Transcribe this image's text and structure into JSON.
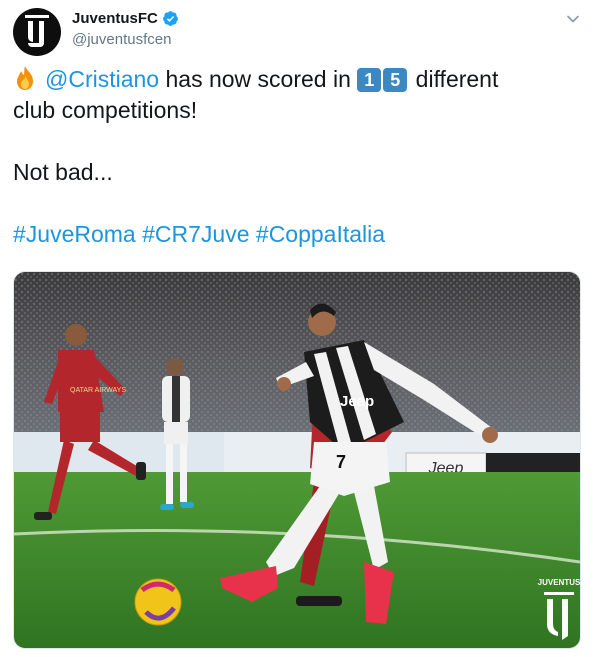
{
  "author": {
    "display_name": "JuventusFC",
    "handle": "@juventusfcen",
    "avatar_icon": "juventus-j-logo-icon",
    "verified_icon": "verified-badge-icon"
  },
  "menu": {
    "icon": "chevron-down-icon"
  },
  "tweet": {
    "emoji_icon": "fire-emoji-icon",
    "mention": "@Cristiano",
    "text_part1": "has now scored in",
    "keycap_1": "1",
    "keycap_2": "5",
    "text_part2": "different",
    "line2": "club competitions!",
    "line3": "Not bad...",
    "hashtags": [
      "#JuveRoma",
      "#CR7Juve",
      "#CoppaItalia"
    ]
  },
  "media": {
    "watermark_text": "JUVENTUS",
    "watermark_icon": "juventus-j-logo-icon",
    "photo_labels": {
      "shirt_sponsor": "Jeep",
      "shirt_number": "7",
      "board_brand": "Jeep",
      "opponent_sponsor": "QATAR AIRWAYS"
    }
  },
  "colors": {
    "link": "#1b95e0",
    "text": "#14171a",
    "secondary": "#657786",
    "verified": "#1da1f2",
    "keycap": "#3b88c3",
    "pitch": "#3f8a2c"
  }
}
